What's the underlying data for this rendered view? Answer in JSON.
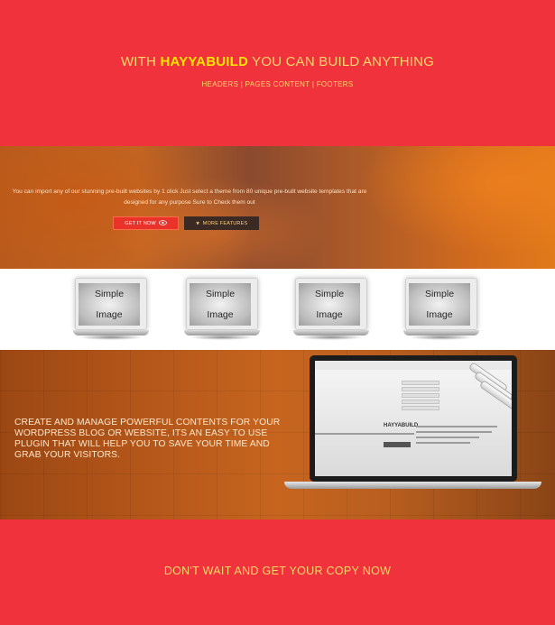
{
  "hero": {
    "title_prefix": "WITH ",
    "title_brand": "HAYYABUILD",
    "title_suffix": " YOU CAN BUILD ANYTHING",
    "subtitle": "HEADERS | PAGES CONTENT | FOOTERS"
  },
  "band": {
    "description": "You can import any of our stunning pre-built websites by 1 click Just select a theme from 80 unique pre-built website templates that are designed for any purpose Sure to Check them out",
    "get_button_label": "GET IT NOW",
    "get_button_icon": "eye-icon",
    "more_button_label": "MORE FEATURES",
    "more_button_icon": "star-icon"
  },
  "laptops": [
    {
      "line1": "Simple",
      "line2": "Image"
    },
    {
      "line1": "Simple",
      "line2": "Image"
    },
    {
      "line1": "Simple",
      "line2": "Image"
    },
    {
      "line1": "Simple",
      "line2": "Image"
    }
  ],
  "feature": {
    "text": "CREATE AND MANAGE POWERFUL CONTENTS FOR YOUR WORDPRESS BLOG OR WEBSITE, ITS AN EASY TO USE PLUGIN THAT WILL HELP YOU TO SAVE YOUR TIME AND GRAB YOUR VISITORS.",
    "screen_brand": "HAYYABUILD"
  },
  "footer": {
    "cta": "DON'T WAIT AND GET YOUR COPY NOW"
  },
  "colors": {
    "red": "#f0323c",
    "gold": "#ffd86a",
    "brand_yellow": "#ffe600"
  }
}
